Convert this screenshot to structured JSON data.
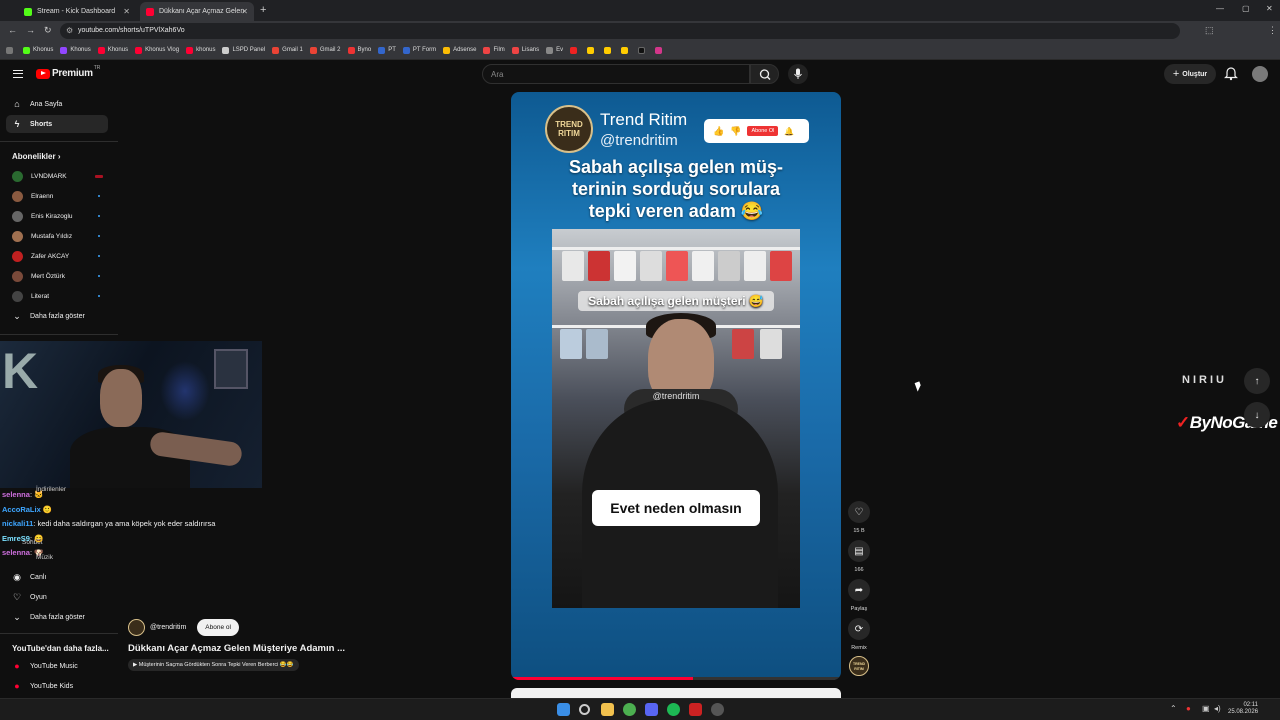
{
  "browser": {
    "tabs": [
      {
        "title": "Stream - Kick Dashboard",
        "color": "#53fc18"
      },
      {
        "title": "Dükkanı Açar Açmaz Gelen",
        "color": "#ff0033"
      }
    ],
    "url": "youtube.com/shorts/uTPVlXah6Vo",
    "bookmarks": [
      "Khonus",
      "Khonus",
      "Khonus",
      "Khonus Vlog",
      "khonus",
      "LSPD Panel",
      "Gmail 1",
      "Gmail 2",
      "Byno",
      "PT",
      "PT Form",
      "Adsense",
      "Film",
      "Lisans",
      "Ev"
    ]
  },
  "youtube": {
    "logo_text": "Premium",
    "logo_sup": "TR",
    "search_placeholder": "Ara",
    "create_label": "Oluştur",
    "nav": {
      "home": "Ana Sayfa",
      "shorts": "Shorts"
    },
    "subs_heading": "Abonelikler",
    "subs": [
      {
        "name": "LVNDMARK",
        "color": "#2a6a30"
      },
      {
        "name": "Elraenn",
        "color": "#8a5a40"
      },
      {
        "name": "Enis Kirazoglu",
        "color": "#666"
      },
      {
        "name": "Mustafa Yıldız",
        "color": "#a07050"
      },
      {
        "name": "Zafer AKCAY",
        "color": "#c02020"
      },
      {
        "name": "Mert Öztürk",
        "color": "#7a4a3a"
      },
      {
        "name": "Literat",
        "color": "#444"
      }
    ],
    "show_more": "Daha fazla göster",
    "under_items": [
      "İndirilenler",
      "Sohbet",
      "Müzik",
      "Canlı",
      "Oyun"
    ],
    "show_more_2": "Daha fazla göster",
    "more_from_yt": "YouTube'dan daha fazla...",
    "yt_apps": [
      "YouTube Music",
      "YouTube Kids"
    ]
  },
  "chat": [
    {
      "user": "selenna",
      "msg": ": 🐱",
      "color": "#d070e0"
    },
    {
      "user": "AccoRaLix",
      "msg": "🙂",
      "color": "#3ea6ff"
    },
    {
      "user": "nickali11",
      "msg": ": kedi daha saldırgan ya ama köpek yok eder saldırırsa",
      "color": "#3ea6ff"
    },
    {
      "user": "EmreS9",
      "msg": ": 😄",
      "color": "#7be0ff"
    },
    {
      "user": "selenna",
      "msg": ": 🐶",
      "color": "#d070e0"
    }
  ],
  "short": {
    "channel_logo": [
      "TREND",
      "RITIM"
    ],
    "channel_name": "Trend Ritim",
    "channel_handle": "@trendritim",
    "subscribe_pill": "Abone Ol",
    "caption": [
      "Sabah açılışa gelen müş-",
      "terinin sorduğu sorulara",
      "tepki veren adam 😂"
    ],
    "video_top_text": "Sabah açılışa gelen müşteri 😅",
    "watermark": "@trendritim",
    "subtitle": "Evet neden olmasın",
    "progress_fraction": 0.55
  },
  "actions": [
    {
      "name": "like",
      "icon": "♡",
      "label": "15 B"
    },
    {
      "name": "comment",
      "icon": "▤",
      "label": "166"
    },
    {
      "name": "share",
      "icon": "➦",
      "label": "Paylaş"
    },
    {
      "name": "remix",
      "icon": "⟳",
      "label": "Remix"
    }
  ],
  "video_info": {
    "channel": "@trendritim",
    "subscribe": "Abone ol",
    "title": "Dükkanı Açar Açmaz Gelen Müşteriye Adamın ...",
    "tag": "▶ Müşterinin Saçma Gördükten Sonra Tepki Veren Berberci 😂😂"
  },
  "overlay": {
    "text_top": "NIRIU",
    "brand": "ByNoGame"
  },
  "taskbar": {
    "time": "02:11",
    "date": "25.08.2026"
  }
}
